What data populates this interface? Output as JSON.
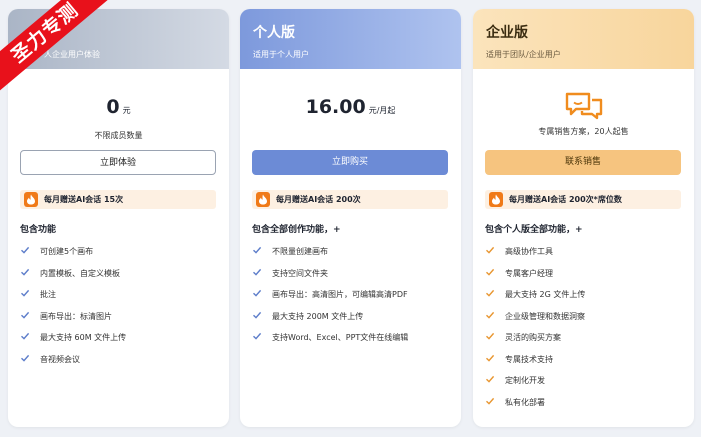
{
  "plans": [
    {
      "title": "",
      "subtitle": "人企业用户体验",
      "price": "0",
      "price_unit": "元",
      "sub_text": "不限成员数量",
      "button_label": "立即体验",
      "gift_text": "每月赠送AI会话 15次",
      "features_title": "包含功能",
      "features": [
        "可创建5个画布",
        "内置模板、自定义模板",
        "批注",
        "画布导出：标清图片",
        "最大支持 60M 文件上传",
        "音视频会议"
      ]
    },
    {
      "title": "个人版",
      "subtitle": "适用于个人用户",
      "price": "16.00",
      "price_unit": "元/月起",
      "sub_text": "",
      "button_label": "立即购买",
      "gift_text": "每月赠送AI会话 200次",
      "features_title": "包含全部创作功能，+",
      "features": [
        "不限量创建画布",
        "支持空间文件夹",
        "画布导出：高清图片，可编辑高清PDF",
        "最大支持 200M 文件上传",
        "支持Word、Excel、PPT文件在线编辑"
      ]
    },
    {
      "title": "企业版",
      "subtitle": "适用于团队/企业用户",
      "price": "",
      "price_unit": "",
      "sub_text": "专属销售方案，20人起售",
      "button_label": "联系销售",
      "gift_text": "每月赠送AI会话 200次*席位数",
      "features_title": "包含个人版全部功能，+",
      "features": [
        "高级协作工具",
        "专属客户经理",
        "最大支持 2G 文件上传",
        "企业级管理和数据洞察",
        "灵活的购买方案",
        "专属技术支持",
        "定制化开发",
        "私有化部署"
      ]
    }
  ],
  "watermark": "圣力专测",
  "colors": {
    "personal_accent": "#6c8bd6",
    "enterprise_accent": "#f6c47f",
    "watermark": "#e8111b",
    "gift_bg": "#fdf0e2"
  },
  "icons": {
    "gift": "fire-icon",
    "check": "check-icon",
    "enterprise": "chat-bubbles-icon"
  }
}
